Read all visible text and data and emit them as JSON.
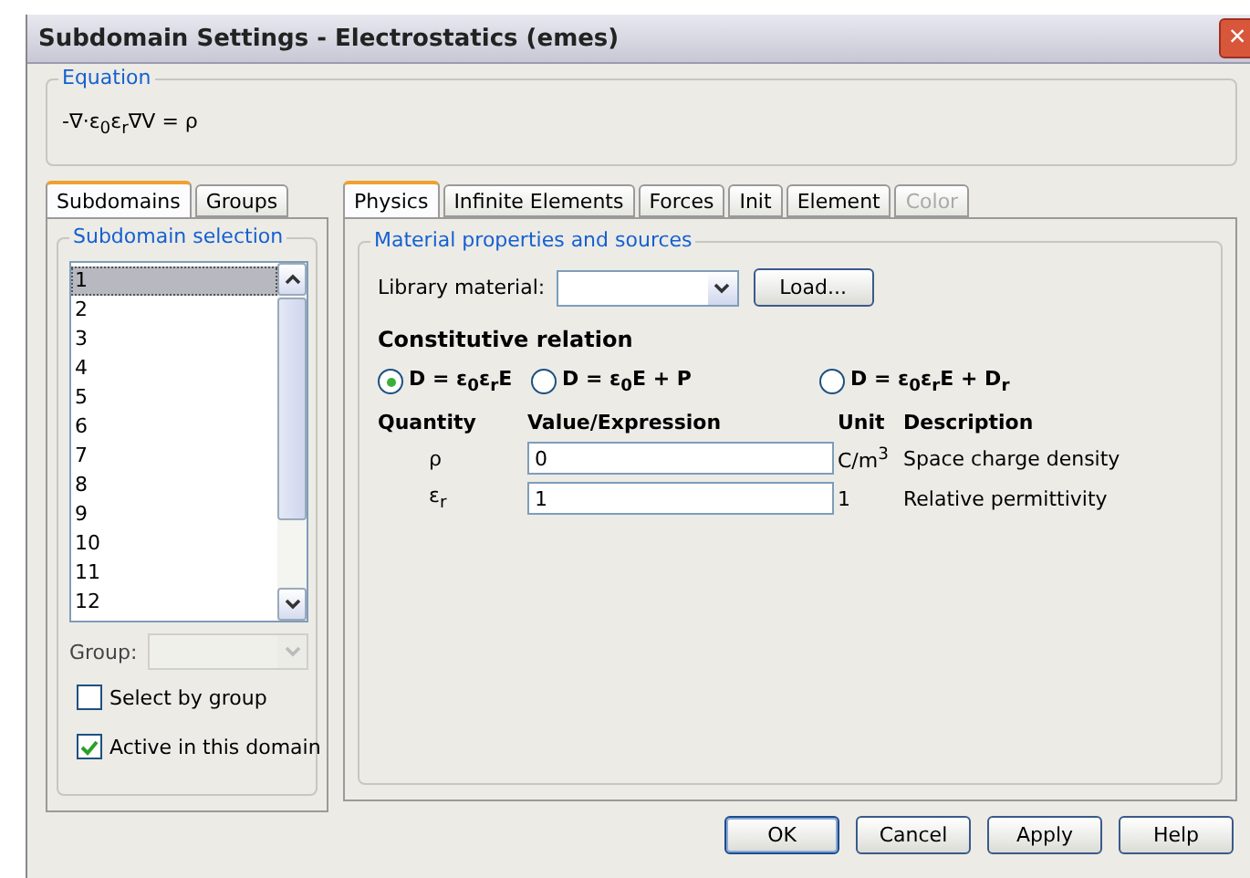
{
  "window": {
    "title": "Subdomain Settings - Electrostatics (emes)",
    "close": "×"
  },
  "equation": {
    "title": "Equation",
    "formula": "-∇·ε$_{0}$ε$_{r}$∇V = ρ"
  },
  "left_tabs": [
    {
      "label": "Subdomains",
      "selected": true
    },
    {
      "label": "Groups",
      "selected": false
    }
  ],
  "subdomain_selection": {
    "title": "Subdomain selection",
    "items": [
      {
        "label": "1",
        "selected": true
      },
      {
        "label": "2",
        "selected": false
      },
      {
        "label": "3",
        "selected": false
      },
      {
        "label": "4",
        "selected": false
      },
      {
        "label": "5",
        "selected": false
      },
      {
        "label": "6",
        "selected": false
      },
      {
        "label": "7",
        "selected": false
      },
      {
        "label": "8",
        "selected": false
      },
      {
        "label": "9",
        "selected": false
      },
      {
        "label": "10",
        "selected": false
      },
      {
        "label": "11",
        "selected": false
      },
      {
        "label": "12",
        "selected": false
      }
    ],
    "group_label": "Group:",
    "group_disabled": true,
    "checkboxes": [
      {
        "label": "Select by group",
        "checked": false
      },
      {
        "label": "Active in this domain",
        "checked": true
      }
    ]
  },
  "right_tabs": [
    {
      "label": "Physics",
      "selected": true,
      "disabled": false
    },
    {
      "label": "Infinite Elements",
      "selected": false,
      "disabled": false
    },
    {
      "label": "Forces",
      "selected": false,
      "disabled": false
    },
    {
      "label": "Init",
      "selected": false,
      "disabled": false
    },
    {
      "label": "Element",
      "selected": false,
      "disabled": false
    },
    {
      "label": "Color",
      "selected": false,
      "disabled": true
    }
  ],
  "material": {
    "title": "Material properties and sources",
    "library_label": "Library material:",
    "load_button": "Load...",
    "relation_title": "Constitutive relation",
    "relations": [
      {
        "label": "D = ε$_{0}$ε$_{r}$E",
        "selected": true
      },
      {
        "label": "D = ε$_{0}$E + P",
        "selected": false
      },
      {
        "label": "D = ε$_{0}$ε$_{r}$E + D$_{r}$",
        "selected": false
      }
    ],
    "columns": [
      "Quantity",
      "Value/Expression",
      "Unit",
      "Description"
    ],
    "rows": [
      {
        "quantity": "ρ",
        "value": "0",
        "unit": "C/m$^{3}$",
        "description": "Space charge density"
      },
      {
        "quantity": "ε$_{r}$",
        "value": "1",
        "unit": "1",
        "description": "Relative permittivity"
      }
    ]
  },
  "buttons": [
    {
      "label": "OK",
      "default": true
    },
    {
      "label": "Cancel",
      "default": false
    },
    {
      "label": "Apply",
      "default": false
    },
    {
      "label": "Help",
      "default": false
    }
  ]
}
